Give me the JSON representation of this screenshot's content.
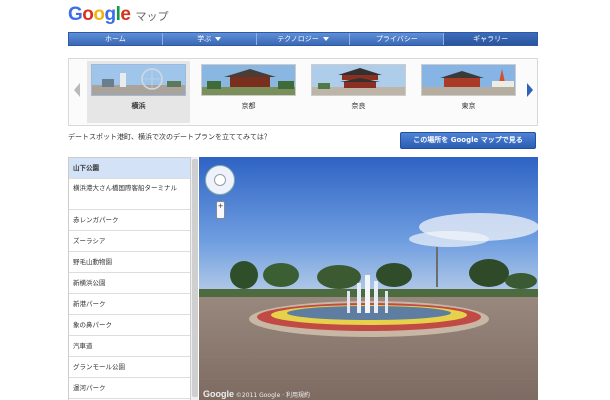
{
  "header": {
    "logo_parts": [
      "G",
      "o",
      "o",
      "g",
      "l",
      "e"
    ],
    "product": "マップ"
  },
  "nav": {
    "items": [
      {
        "label": "ホーム"
      },
      {
        "label": "学ぶ"
      },
      {
        "label": "テクノロジー"
      },
      {
        "label": "プライバシー"
      },
      {
        "label": "ギャラリー"
      }
    ]
  },
  "carousel": {
    "thumbs": [
      {
        "caption": "横浜"
      },
      {
        "caption": "京都"
      },
      {
        "caption": "奈良"
      },
      {
        "caption": "東京"
      }
    ]
  },
  "info": {
    "text": "デートスポット港町、横浜で次のデートプランを立ててみては？",
    "button": "この場所を Google マップで見る"
  },
  "spots": {
    "items": [
      {
        "label": "山下公園"
      },
      {
        "label": "横浜港大さん橋国際客船ターミナル"
      },
      {
        "label": "赤レンガパーク"
      },
      {
        "label": "ズーラシア"
      },
      {
        "label": "野毛山動物園"
      },
      {
        "label": "新横浜公園"
      },
      {
        "label": "新港パーク"
      },
      {
        "label": "象の鼻パーク"
      },
      {
        "label": "汽車道"
      },
      {
        "label": "グランモール公園"
      },
      {
        "label": "運河パーク"
      }
    ]
  },
  "streetview": {
    "logo": "Google",
    "credit": "©2011 Google · 利用規約"
  }
}
